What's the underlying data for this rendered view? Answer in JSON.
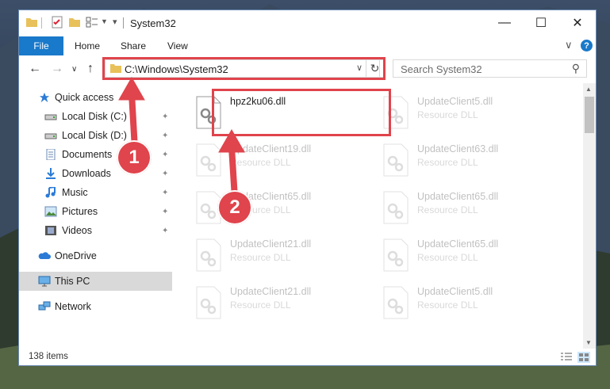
{
  "window": {
    "title": "System32",
    "min_glyph": "—",
    "max_glyph": "☐",
    "close_glyph": "✕"
  },
  "ribbon": {
    "tabs": [
      "File",
      "Home",
      "Share",
      "View"
    ],
    "help_glyph": "?",
    "collapse_glyph": "∨"
  },
  "nav": {
    "back_glyph": "←",
    "forward_glyph": "→",
    "recent_glyph": "∨",
    "up_glyph": "↑",
    "address": "C:\\Windows\\System32",
    "address_dd_glyph": "∨",
    "refresh_glyph": "↻",
    "search_placeholder": "Search System32",
    "search_glyph": "⚲"
  },
  "sidebar": {
    "items": [
      {
        "label": "Quick access",
        "icon": "star-icon",
        "pinned": false
      },
      {
        "label": "Local Disk (C:)",
        "icon": "drive-icon",
        "pinned": true
      },
      {
        "label": "Local Disk (D:)",
        "icon": "drive-icon",
        "pinned": true
      },
      {
        "label": "Documents",
        "icon": "documents-icon",
        "pinned": true
      },
      {
        "label": "Downloads",
        "icon": "downloads-icon",
        "pinned": true
      },
      {
        "label": "Music",
        "icon": "music-icon",
        "pinned": true
      },
      {
        "label": "Pictures",
        "icon": "pictures-icon",
        "pinned": true
      },
      {
        "label": "Videos",
        "icon": "videos-icon",
        "pinned": true
      },
      {
        "label": "OneDrive",
        "icon": "onedrive-icon",
        "pinned": false
      },
      {
        "label": "This PC",
        "icon": "pc-icon",
        "pinned": false
      },
      {
        "label": "Network",
        "icon": "network-icon",
        "pinned": false
      }
    ],
    "pin_glyph": "📌"
  },
  "files": [
    {
      "name": "hpz2ku06.dll",
      "type": "",
      "faded": false
    },
    {
      "name": "UpdateClient5.dll",
      "type": "Resource DLL",
      "faded": true
    },
    {
      "name": "UpdateClient19.dll",
      "type": "Resource DLL",
      "faded": true
    },
    {
      "name": "UpdateClient63.dll",
      "type": "Resource DLL",
      "faded": true
    },
    {
      "name": "UpdateClient65.dll",
      "type": "Resource DLL",
      "faded": true
    },
    {
      "name": "UpdateClient65.dll",
      "type": "Resource DLL",
      "faded": true
    },
    {
      "name": "UpdateClient21.dll",
      "type": "Resource DLL",
      "faded": true
    },
    {
      "name": "UpdateClient65.dll",
      "type": "Resource DLL",
      "faded": true
    },
    {
      "name": "UpdateClient21.dll",
      "type": "Resource DLL",
      "faded": true
    },
    {
      "name": "UpdateClient5.dll",
      "type": "Resource DLL",
      "faded": true
    }
  ],
  "status": {
    "item_count": "138 items"
  },
  "markers": {
    "step1": "1",
    "step2": "2"
  },
  "colors": {
    "accent": "#1979ca",
    "highlight": "#e0444c"
  }
}
